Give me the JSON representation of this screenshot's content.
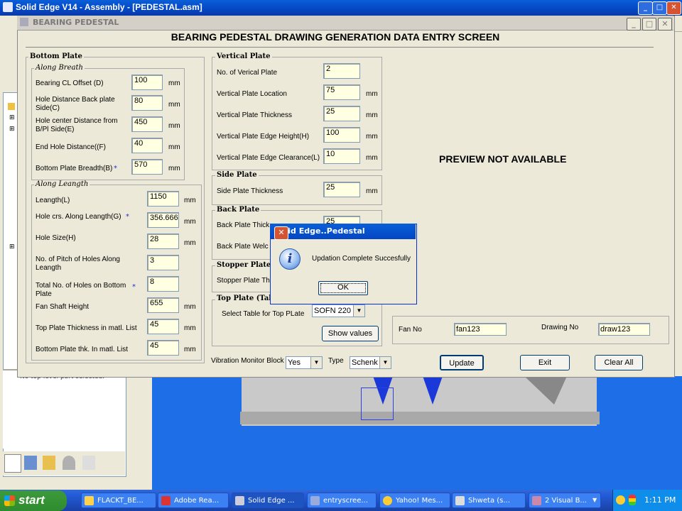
{
  "background_app": {
    "title": "Solid Edge V14 - Assembly - [PEDESTAL.asm]",
    "panel_text": "No top level part selected."
  },
  "taskbar": {
    "start_label": "start",
    "items": [
      {
        "label": "FLACKT_BE..."
      },
      {
        "label": "Adobe Rea..."
      },
      {
        "label": "Solid Edge ..."
      },
      {
        "label": "entryscree..."
      },
      {
        "label": "Yahoo! Mes..."
      },
      {
        "label": "Shweta (s..."
      },
      {
        "label": "2 Visual B..."
      }
    ],
    "clock": "1:11 PM"
  },
  "dialog": {
    "title": "BEARING PEDESTAL",
    "heading": "BEARING PEDESTAL DRAWING GENERATION  DATA ENTRY SCREEN",
    "bottom_plate": {
      "label": "Bottom Plate",
      "along_breath": {
        "label": "Along Breath",
        "fields": [
          {
            "label": "Bearing CL Offset (D)",
            "value": "100",
            "unit": "mm"
          },
          {
            "label": "Hole Distance Back plate Side(C)",
            "value": "80",
            "unit": "mm"
          },
          {
            "label": "Hole center  Distance from B/Pl Side(E)",
            "value": "450",
            "unit": "mm"
          },
          {
            "label": "End Hole Distance((F)",
            "value": "40",
            "unit": "mm"
          },
          {
            "label": "Bottom Plate Breadth(B)",
            "value": "570",
            "unit": "mm"
          }
        ]
      },
      "along_length": {
        "label": "Along Leangth",
        "fields": [
          {
            "label": "Leangth(L)",
            "value": "1150",
            "unit": "mm"
          },
          {
            "label": "Hole crs. Along Leangth(G)",
            "value": "356.666",
            "unit": "mm"
          },
          {
            "label": "Hole Size(H)",
            "value": "28",
            "unit": "mm"
          },
          {
            "label": "No. of Pitch of Holes Along Leangth",
            "value": "3",
            "unit": ""
          },
          {
            "label": "Total No. of Holes on Bottom Plate",
            "value": "8",
            "unit": ""
          },
          {
            "label": "Fan Shaft Height",
            "value": "655",
            "unit": "mm"
          },
          {
            "label": "Top Plate Thickness in matl. List",
            "value": "45",
            "unit": "mm"
          },
          {
            "label": "Bottom Plate thk. In matl. List",
            "value": "45",
            "unit": "mm"
          }
        ]
      }
    },
    "vertical_plate": {
      "label": "Vertical Plate",
      "fields": [
        {
          "label": "No. of Verical Plate",
          "value": "2",
          "unit": ""
        },
        {
          "label": "Vertical Plate Location",
          "value": "75",
          "unit": "mm"
        },
        {
          "label": "Vertical Plate Thickness",
          "value": "25",
          "unit": "mm"
        },
        {
          "label": "Vertical Plate Edge Height(H)",
          "value": "100",
          "unit": "mm"
        },
        {
          "label": "Vertical Plate Edge Clearance(L)",
          "value": "10",
          "unit": "mm"
        }
      ]
    },
    "side_plate": {
      "label": "Side Plate",
      "field_label": "Side Plate Thickness",
      "value": "25",
      "unit": "mm"
    },
    "back_plate": {
      "label": "Back Plate",
      "field1_label": "Back Plate Thick",
      "field1_value": "25",
      "field2_label": "Back Plate Welc"
    },
    "stopper_plate": {
      "label": "Stopper Plate",
      "field_label": "Stopper Plate Th"
    },
    "top_plate": {
      "label": "Top Plate (Tabl",
      "select_label": "Select Table for Top PLate",
      "select_value": "SOFN 220",
      "show_values": "Show values"
    },
    "preview_text": "PREVIEW NOT AVAILABLE",
    "fan_no": {
      "label": "Fan No",
      "value": "fan123"
    },
    "drawing_no": {
      "label": "Drawing No",
      "value": "draw123"
    },
    "vibration": {
      "label": "Vibration Monitor Block",
      "value": "Yes"
    },
    "type": {
      "label": "Type",
      "value": "Schenk"
    },
    "buttons": {
      "update": "Update",
      "exit": "Exit",
      "clear_all": "Clear All"
    }
  },
  "message_box": {
    "title": "Solid Edge..Pedestal",
    "text": "Updation Complete Succesfully",
    "ok": "OK"
  }
}
